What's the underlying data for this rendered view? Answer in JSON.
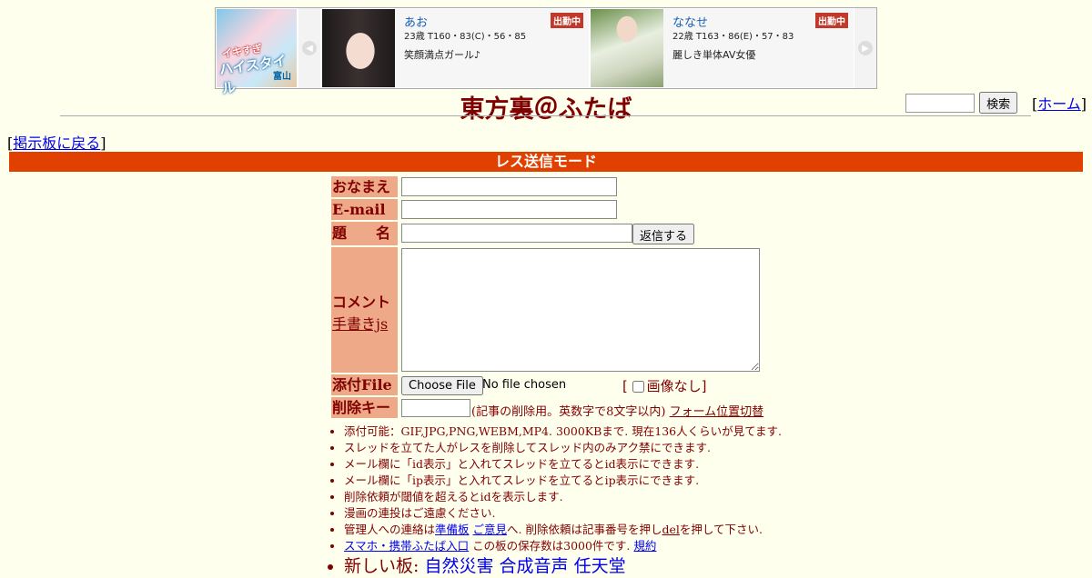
{
  "ad": {
    "banner": {
      "line1": "イキすぎ",
      "line2": "ハイスタイル",
      "line3": "富山"
    },
    "cards": [
      {
        "name": "あお",
        "badge": "出勤中",
        "stats": "23歳 T160・83(C)・56・85",
        "catch": "笑顔満点ガール♪"
      },
      {
        "name": "ななせ",
        "badge": "出勤中",
        "stats": "22歳 T163・86(E)・57・83",
        "catch": "麗しき単体AV女優"
      }
    ],
    "prev_icon": "chevron-left-icon",
    "next_icon": "chevron-right-icon"
  },
  "header": {
    "title": "東方裏＠ふたば",
    "search_button": "検索",
    "home_prefix": "[",
    "home_link": "ホーム",
    "home_suffix": "]"
  },
  "nav": {
    "back_prefix": "[",
    "back_link": "掲示板に戻る",
    "back_suffix": "]"
  },
  "mode_bar": "レス送信モード",
  "form": {
    "name_label": "おなまえ",
    "email_label": "E-mail",
    "subject_label": "題　　名",
    "submit": "返信する",
    "comment_label": "コメント",
    "handwriting_link": "手書きjs",
    "file_label": "添付File",
    "file_button": "Choose File",
    "file_status": "No file chosen",
    "noimage_prefix": "[",
    "noimage_label": "画像なし",
    "noimage_suffix": "]",
    "delkey_label": "削除キー",
    "delkey_note": "(記事の削除用。英数字で8文字以内)",
    "position_toggle": "フォーム位置切替"
  },
  "notes": {
    "n1": "添付可能：GIF,JPG,PNG,WEBM,MP4. 3000KBまで. 現在136人くらいが見てます.",
    "n2": "スレッドを立てた人がレスを削除してスレッド内のみアク禁にできます.",
    "n3": "メール欄に「id表示」と入れてスレッドを立てるとid表示にできます.",
    "n4": "メール欄に「ip表示」と入れてスレッドを立てるとip表示にできます.",
    "n5": "削除依頼が閾値を超えるとidを表示します.",
    "n6": "漫画の連投はご遠慮ください.",
    "n7_pre": "管理人への連絡は",
    "n7_link1": "準備板",
    "n7_link2": "ご意見",
    "n7_mid": "へ. 削除依頼は記事番号を押し",
    "n7_link3": "del",
    "n7_post": "を押して下さい.",
    "n8_link": "スマホ・携帯ふたば入口",
    "n8_text": "この板の保存数は3000件です.",
    "n8_link2": "規約",
    "n9_pre": "新しい板:",
    "n9_link1": "自然災害",
    "n9_link2": "合成音声",
    "n9_link3": "任天堂"
  },
  "colors": {
    "background": "#ffffee",
    "text": "#800000",
    "mode_bar": "#e04000",
    "label_bg": "#eeaa88",
    "link": "#0000ee"
  }
}
